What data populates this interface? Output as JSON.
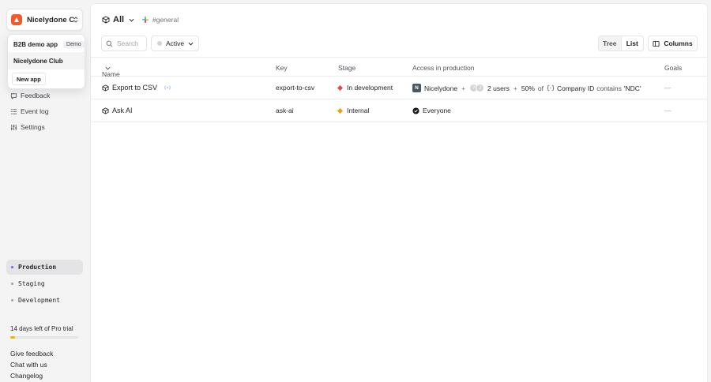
{
  "sidebar": {
    "app_name": "Nicelydone Club",
    "dropdown": {
      "items": [
        {
          "label": "B2B demo app",
          "badge": "Demo"
        },
        {
          "label": "Nicelydone Club",
          "badge": ""
        }
      ],
      "new_app_label": "New app"
    },
    "nav": [
      {
        "label": "Feedback",
        "icon": "message-icon"
      },
      {
        "label": "Event log",
        "icon": "list-icon"
      },
      {
        "label": "Settings",
        "icon": "sliders-icon"
      }
    ],
    "environments": [
      {
        "label": "Production",
        "active": true
      },
      {
        "label": "Staging",
        "active": false
      },
      {
        "label": "Development",
        "active": false
      }
    ],
    "trial": {
      "text": "14 days left of Pro trial",
      "progress_percent": 7
    },
    "footer_links": [
      "Give feedback",
      "Chat with us",
      "Changelog"
    ]
  },
  "header": {
    "scope_label": "All",
    "channel": "#general"
  },
  "toolbar": {
    "search_placeholder": "Search",
    "status_value": "Active",
    "view_options": [
      "Tree",
      "List"
    ],
    "active_view": "List",
    "columns_label": "Columns"
  },
  "table": {
    "headers": {
      "name": "Name",
      "key": "Key",
      "stage": "Stage",
      "access": "Access in production",
      "goals": "Goals"
    },
    "rows": [
      {
        "name": "Export to CSV",
        "key": "export-to-csv",
        "stage": "In development",
        "stage_color": "#ef4444",
        "access": {
          "company_initial": "N",
          "company": "Nicelydone",
          "plus": "+",
          "users": "2 users",
          "percent": "50%",
          "of": "of",
          "filter_attr": "Company ID",
          "filter_op": "contains",
          "filter_value": "'NDC'"
        },
        "goals": "—"
      },
      {
        "name": "Ask AI",
        "key": "ask-ai",
        "stage": "Internal",
        "stage_color": "#f59e0b",
        "access": {
          "everyone": "Everyone"
        },
        "goals": "—"
      }
    ]
  },
  "colors": {
    "accent": "#ee5b2c",
    "trial_bar": "#f5b400"
  }
}
